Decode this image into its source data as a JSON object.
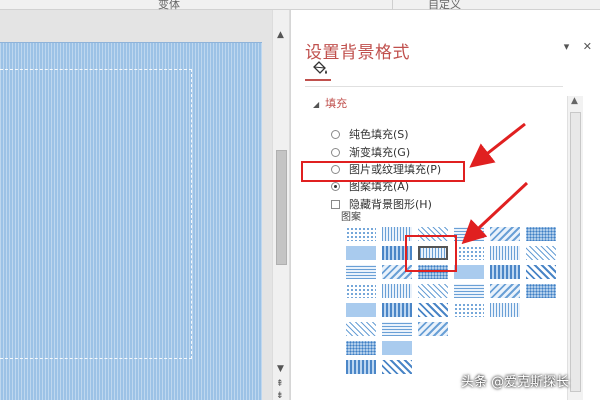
{
  "ribbon": {
    "variant_label": "变体",
    "custom_label": "自定义"
  },
  "pane": {
    "title": "设置背景格式",
    "pin_symbol": "▾",
    "close_symbol": "✕",
    "section_label": "填充",
    "options": [
      {
        "label": "纯色填充(S)",
        "selected": false
      },
      {
        "label": "渐变填充(G)",
        "selected": false
      },
      {
        "label": "图片或纹理填充(P)",
        "selected": false
      },
      {
        "label": "图案填充(A)",
        "selected": true
      }
    ],
    "hide_background_label": "隐藏背景图形(H)",
    "pattern_label": "图案"
  },
  "watermark": "头条 @爱克斯探长",
  "colors": {
    "accent": "#c0504d",
    "slide": "#9cc2e6",
    "annotation": "#e02020"
  },
  "icons": [
    "paint-bucket-icon",
    "scroll-up-icon",
    "scroll-down-icon",
    "collapse-triangle-icon",
    "pin-icon",
    "close-icon"
  ]
}
